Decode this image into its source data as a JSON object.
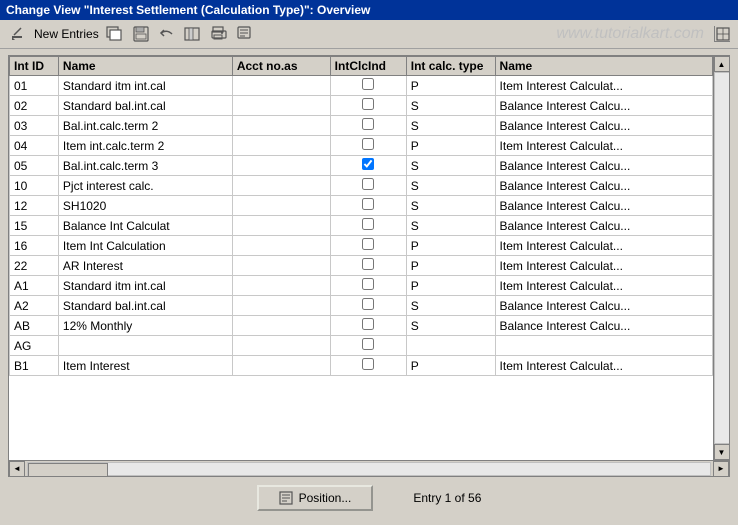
{
  "window": {
    "title": "Change View \"Interest Settlement (Calculation Type)\": Overview"
  },
  "toolbar": {
    "new_entries_label": "New Entries",
    "icons": [
      {
        "name": "edit-icon",
        "symbol": "✎"
      },
      {
        "name": "save-icon",
        "symbol": "💾"
      },
      {
        "name": "copy-icon",
        "symbol": "⎘"
      },
      {
        "name": "delete-icon",
        "symbol": "🗑"
      },
      {
        "name": "print-icon",
        "symbol": "🖶"
      },
      {
        "name": "find-icon",
        "symbol": "🔍"
      }
    ]
  },
  "watermark": "www.tutorialkart.com",
  "table": {
    "columns": [
      {
        "key": "intid",
        "label": "Int ID"
      },
      {
        "key": "name",
        "label": "Name"
      },
      {
        "key": "acctno",
        "label": "Acct no.as"
      },
      {
        "key": "intclcind",
        "label": "IntClcInd"
      },
      {
        "key": "intcalctype",
        "label": "Int calc. type"
      },
      {
        "key": "name2",
        "label": "Name"
      }
    ],
    "rows": [
      {
        "intid": "01",
        "name": "Standard itm int.cal",
        "acctno": "",
        "intclcind": false,
        "intcalctype": "P",
        "name2": "Item Interest Calculat..."
      },
      {
        "intid": "02",
        "name": "Standard bal.int.cal",
        "acctno": "",
        "intclcind": false,
        "intcalctype": "S",
        "name2": "Balance Interest Calcu..."
      },
      {
        "intid": "03",
        "name": "Bal.int.calc.term 2",
        "acctno": "",
        "intclcind": false,
        "intcalctype": "S",
        "name2": "Balance Interest Calcu..."
      },
      {
        "intid": "04",
        "name": "Item int.calc.term 2",
        "acctno": "",
        "intclcind": false,
        "intcalctype": "P",
        "name2": "Item Interest Calculat..."
      },
      {
        "intid": "05",
        "name": "Bal.int.calc.term 3",
        "acctno": "",
        "intclcind": true,
        "intcalctype": "S",
        "name2": "Balance Interest Calcu..."
      },
      {
        "intid": "10",
        "name": "Pjct interest calc.",
        "acctno": "",
        "intclcind": false,
        "intcalctype": "S",
        "name2": "Balance Interest Calcu..."
      },
      {
        "intid": "12",
        "name": "SH1020",
        "acctno": "",
        "intclcind": false,
        "intcalctype": "S",
        "name2": "Balance Interest Calcu..."
      },
      {
        "intid": "15",
        "name": "Balance Int Calculat",
        "acctno": "",
        "intclcind": false,
        "intcalctype": "S",
        "name2": "Balance Interest Calcu..."
      },
      {
        "intid": "16",
        "name": "Item Int Calculation",
        "acctno": "",
        "intclcind": false,
        "intcalctype": "P",
        "name2": "Item Interest Calculat..."
      },
      {
        "intid": "22",
        "name": "AR Interest",
        "acctno": "",
        "intclcind": false,
        "intcalctype": "P",
        "name2": "Item Interest Calculat..."
      },
      {
        "intid": "A1",
        "name": "Standard itm int.cal",
        "acctno": "",
        "intclcind": false,
        "intcalctype": "P",
        "name2": "Item Interest Calculat..."
      },
      {
        "intid": "A2",
        "name": "Standard bal.int.cal",
        "acctno": "",
        "intclcind": false,
        "intcalctype": "S",
        "name2": "Balance Interest Calcu..."
      },
      {
        "intid": "AB",
        "name": "12% Monthly",
        "acctno": "",
        "intclcind": false,
        "intcalctype": "S",
        "name2": "Balance Interest Calcu..."
      },
      {
        "intid": "AG",
        "name": "",
        "acctno": "",
        "intclcind": false,
        "intcalctype": "",
        "name2": ""
      },
      {
        "intid": "B1",
        "name": "Item Interest",
        "acctno": "",
        "intclcind": false,
        "intcalctype": "P",
        "name2": "Item Interest Calculat..."
      }
    ]
  },
  "footer": {
    "position_button_label": "Position...",
    "entry_info": "Entry 1 of 56"
  }
}
